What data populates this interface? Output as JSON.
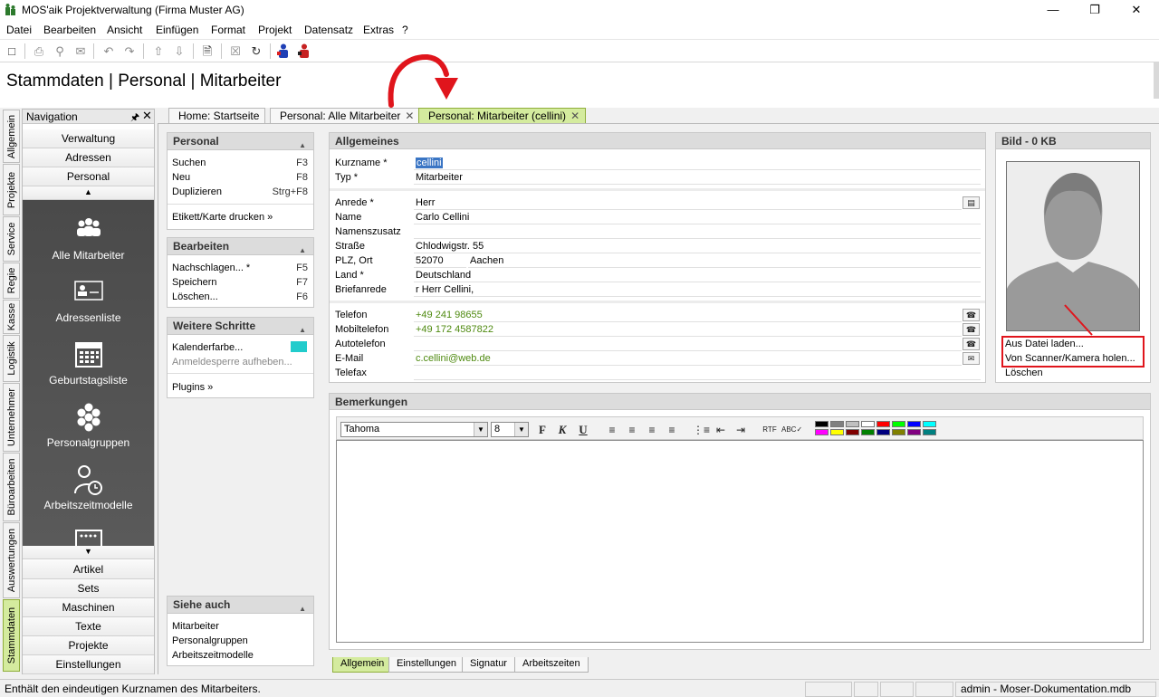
{
  "window": {
    "title": "MOS'aik Projektverwaltung (Firma Muster AG)",
    "minimize": "—",
    "maximize": "❐",
    "close": "✕"
  },
  "menu": [
    "Datei",
    "Bearbeiten",
    "Ansicht",
    "Einfügen",
    "Format",
    "Projekt",
    "Datensatz",
    "Extras",
    "?"
  ],
  "heading": "Stammdaten | Personal | Mitarbeiter",
  "vertical_tabs": [
    "Allgemein",
    "Projekte",
    "Service",
    "Regie",
    "Kasse",
    "Logistik",
    "Unternehmer",
    "Büroarbeiten",
    "Auswertungen",
    "Stammdaten"
  ],
  "navigation": {
    "title": "Navigation",
    "pin": "🖈",
    "close": "✕",
    "top_buttons": [
      "Verwaltung",
      "Adressen",
      "Personal"
    ],
    "scroll_up": "▲",
    "scroll_down": "▼",
    "items": [
      {
        "label": "Alle Mitarbeiter",
        "icon": "people-group-icon"
      },
      {
        "label": "Adressenliste",
        "icon": "address-card-icon"
      },
      {
        "label": "Geburtstagsliste",
        "icon": "calendar-icon"
      },
      {
        "label": "Personalgruppen",
        "icon": "hexagon-group-icon"
      },
      {
        "label": "Arbeitszeitmodelle",
        "icon": "person-clock-icon"
      }
    ],
    "bottom_buttons": [
      "Artikel",
      "Sets",
      "Maschinen",
      "Texte",
      "Projekte",
      "Einstellungen"
    ]
  },
  "doc_tabs": [
    {
      "label": "Home: Startseite",
      "closable": false
    },
    {
      "label": "Personal: Alle Mitarbeiter",
      "closable": true
    },
    {
      "label": "Personal: Mitarbeiter (cellini)",
      "closable": true,
      "active": true
    }
  ],
  "tab_close_glyph": "✕",
  "panels": {
    "personal": {
      "title": "Personal",
      "rows": [
        {
          "label": "Suchen",
          "key": "F3"
        },
        {
          "label": "Neu",
          "key": "F8"
        },
        {
          "label": "Duplizieren",
          "key": "Strg+F8"
        }
      ],
      "extra": "Etikett/Karte drucken »"
    },
    "bearbeiten": {
      "title": "Bearbeiten",
      "rows": [
        {
          "label": "Nachschlagen... *",
          "key": "F5"
        },
        {
          "label": "Speichern",
          "key": "F7"
        },
        {
          "label": "Löschen...",
          "key": "F6"
        }
      ]
    },
    "weitere": {
      "title": "Weitere Schritte",
      "kalender": "Kalenderfarbe...",
      "kalender_color": "#22cccc",
      "anmeldesperre": "Anmeldesperre aufheben...",
      "plugins": "Plugins »"
    },
    "siehe": {
      "title": "Siehe auch",
      "links": [
        "Mitarbeiter",
        "Personalgruppen",
        "Arbeitszeitmodelle"
      ]
    },
    "caret": "▲"
  },
  "allgemeines": {
    "title": "Allgemeines",
    "kurzname_label": "Kurzname *",
    "kurzname": "cellini",
    "typ_label": "Typ *",
    "typ": "Mitarbeiter",
    "anrede_label": "Anrede *",
    "anrede": "Herr",
    "name_label": "Name",
    "name": "Carlo Cellini",
    "namenszusatz_label": "Namenszusatz",
    "namenszusatz": "",
    "strasse_label": "Straße",
    "strasse": "Chlodwigstr. 55",
    "plz_label": "PLZ, Ort",
    "plz": "52070",
    "ort": "Aachen",
    "land_label": "Land *",
    "land": "Deutschland",
    "briefanrede_label": "Briefanrede",
    "briefanrede": "r Herr Cellini,",
    "telefon_label": "Telefon",
    "telefon": "+49 241 98655",
    "mobil_label": "Mobiltelefon",
    "mobil": "+49 172 4587822",
    "autotelefon_label": "Autotelefon",
    "autotelefon": "",
    "email_label": "E-Mail",
    "email": "c.cellini@web.de",
    "telefax_label": "Telefax",
    "telefax": ""
  },
  "bild": {
    "title": "Bild - 0 KB",
    "aus_datei": "Aus Datei laden...",
    "scanner": "Von Scanner/Kamera holen...",
    "loeschen": "Löschen",
    "highlight_color": "#e0151c"
  },
  "bemerkungen": {
    "title": "Bemerkungen",
    "font": "Tahoma",
    "size": "8",
    "bold": "F",
    "italic": "K",
    "underline": "U",
    "text": "",
    "colors": [
      "#000000",
      "#808080",
      "#c0c0c0",
      "#ffffff",
      "#ff0000",
      "#00ff00",
      "#0000ff",
      "#00ffff",
      "#ff00ff",
      "#ffff00",
      "#800000",
      "#008000",
      "#000080",
      "#808000",
      "#800080",
      "#008080"
    ]
  },
  "bottom_tabs": [
    "Allgemein",
    "Einstellungen",
    "Signatur",
    "Arbeitszeiten"
  ],
  "status": {
    "text": "Enthält den eindeutigen Kurznamen des Mitarbeiters.",
    "db": "admin - Moser-Dokumentation.mdb"
  },
  "annotation_arrow_color": "#e0151c"
}
